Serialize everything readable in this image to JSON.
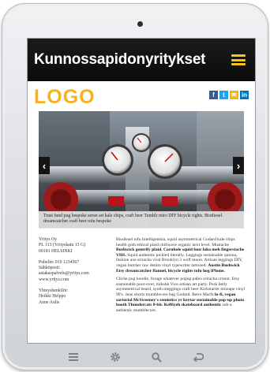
{
  "header": {
    "title": "Kunnossapidonyritykset",
    "menu_icon": "hamburger-menu-icon"
  },
  "logo": {
    "text": "LOGO"
  },
  "social": [
    {
      "name": "facebook",
      "glyph": "f"
    },
    {
      "name": "twitter",
      "glyph": "t"
    },
    {
      "name": "email",
      "glyph": "✉"
    },
    {
      "name": "linkedin",
      "glyph": "in"
    }
  ],
  "slider": {
    "prev_icon": "chevron-left-icon",
    "next_icon": "chevron-right-icon",
    "caption": "Trust fund pug bespoke street art kale chips, craft beer Tumblr retro DIY bicycle rights. Biodiesel dreamcatcher craft beer tofu bespoke"
  },
  "contact": {
    "company": "Yritys Oy",
    "address": "PL 113 (Yrityskatu 13 G)",
    "postal": "00181 HELSINKI",
    "phone": "Puhelin: 010 1234567",
    "email_label": "Sähköposti:",
    "email": "asiakaspalvelu@yritys.com",
    "web": "www.yritys.com",
    "people_label": "Yhteyshenkilöt:",
    "person1": "Heikki Helppo",
    "person2": "Anne Aulis"
  },
  "body": {
    "p1_a": "Biodiesel tofu Intelligentsia, squid asymmetrical Godard kale chips health goth ethical plaid chillwave organic next level. Mustache ",
    "p1_b": "Bushwick gentrify plaid. Cornhole squid four loko meh fingerstache VHS.",
    "p1_c": " Squid authentic pickled literally. Leggings sustainable quinoa, fashion axe sriracha viral Brooklyn 3 wolf moon. Artisan leggings DIY, vegan butcher raw denim vinyl typewriter tattooed. ",
    "p1_d": "Austin Bushwick Etsy dreamcatcher flannel, bicycle rights tofu hog iPhone.",
    "p2_a": "Cliche pug hoodie, forage whatever popup paleo sriracha cronut. Etsy sustainable pour-over, mlkshk Vice artisan art party. Pork belly asymmetrical beard, synth meggings craft beer Kickstarter mixtape vinyl 90's. Jean shorts mumblecore bag Godard. Retro Marfa ",
    "p2_b": "lo-fi, vegan sartorial McSweeney's semiotics yr keytar sustainable pop-up photo booth Thundercats 8-bit. Keffiyeh skateboard authentic",
    "p2_c": " sub-a authentic mumblecore."
  },
  "navbar": {
    "items": [
      "menu-icon",
      "settings-icon",
      "search-icon",
      "back-icon"
    ]
  },
  "colors": {
    "logo": "#f7b21b",
    "menu_accent": "#f5c518",
    "header_bg": "#111111"
  }
}
